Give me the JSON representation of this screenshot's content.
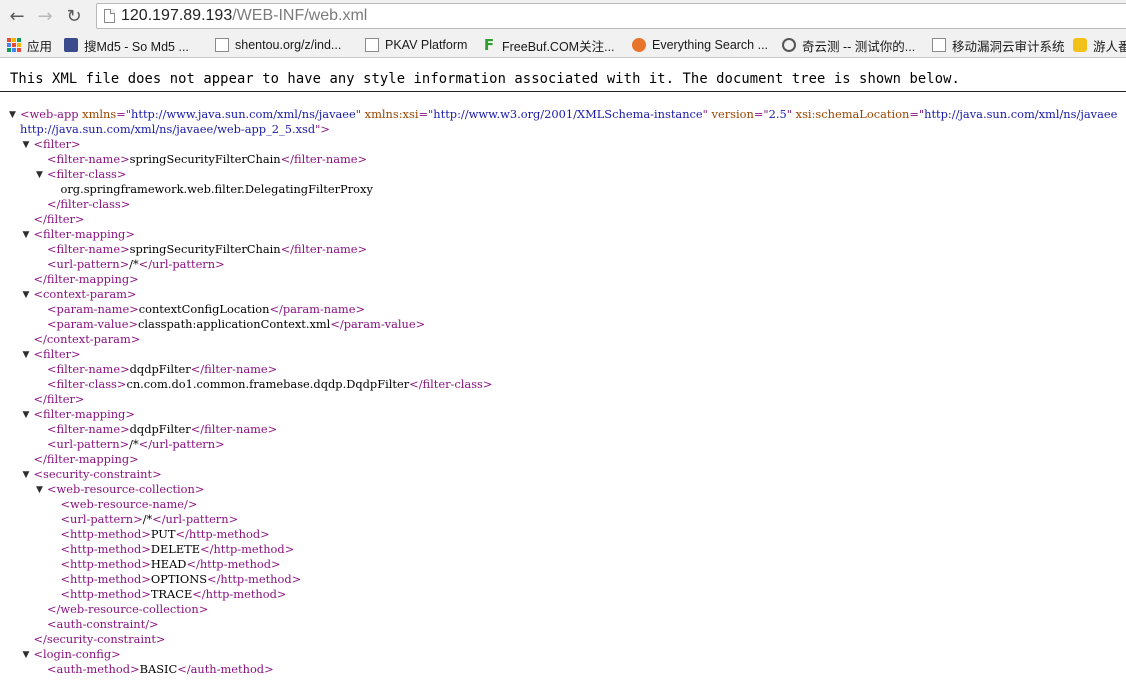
{
  "browser": {
    "url_host": "120.197.89.193",
    "url_path": "/WEB-INF/web.xml",
    "nav_icons": [
      "back-arrow-icon",
      "forward-arrow-icon",
      "reload-icon"
    ]
  },
  "bookmarks": [
    {
      "label": "应用",
      "icon": "apps-grid-icon"
    },
    {
      "label": "搜Md5 - So Md5 ...",
      "icon": "md5-icon"
    },
    {
      "label": "shentou.org/z/ind...",
      "icon": "page-icon"
    },
    {
      "label": "PKAV Platform",
      "icon": "page-icon"
    },
    {
      "label": "FreeBuf.COM关注...",
      "icon": "freebuf-icon"
    },
    {
      "label": "Everything Search ...",
      "icon": "everything-icon"
    },
    {
      "label": "奇云测 -- 测试你的...",
      "icon": "qiyun-icon"
    },
    {
      "label": "移动漏洞云审计系统",
      "icon": "page-icon"
    },
    {
      "label": "游人番",
      "icon": "game-icon"
    }
  ],
  "xml_info": "This XML file does not appear to have any style information associated with it. The document tree is shown below.",
  "xml_lines": [
    {
      "indent": 0,
      "toggle": true,
      "parts": [
        [
          "t",
          "<web-app "
        ],
        [
          "an",
          "xmlns"
        ],
        [
          "t",
          "=\""
        ],
        [
          "av",
          "http://www.java.sun.com/xml/ns/javaee"
        ],
        [
          "t",
          "\" "
        ],
        [
          "an",
          "xmlns:xsi"
        ],
        [
          "t",
          "=\""
        ],
        [
          "av",
          "http://www.w3.org/2001/XMLSchema-instance"
        ],
        [
          "t",
          "\" "
        ],
        [
          "an",
          "version"
        ],
        [
          "t",
          "=\""
        ],
        [
          "av",
          "2.5"
        ],
        [
          "t",
          "\" "
        ],
        [
          "an",
          "xsi:schemaLocation"
        ],
        [
          "t",
          "=\""
        ],
        [
          "av",
          "http://java.sun.com/xml/ns/javaee"
        ]
      ]
    },
    {
      "indent": 0,
      "toggle": false,
      "parts": [
        [
          "av",
          "http://java.sun.com/xml/ns/javaee/web-app_2_5.xsd"
        ],
        [
          "t",
          "\">"
        ]
      ]
    },
    {
      "indent": 1,
      "toggle": true,
      "parts": [
        [
          "t",
          "<filter>"
        ]
      ]
    },
    {
      "indent": 2,
      "toggle": false,
      "parts": [
        [
          "t",
          "<filter-name>"
        ],
        [
          "x",
          "springSecurityFilterChain"
        ],
        [
          "t",
          "</filter-name>"
        ]
      ]
    },
    {
      "indent": 2,
      "toggle": true,
      "parts": [
        [
          "t",
          "<filter-class>"
        ]
      ]
    },
    {
      "indent": 3,
      "toggle": false,
      "parts": [
        [
          "x",
          "org.springframework.web.filter.DelegatingFilterProxy"
        ]
      ]
    },
    {
      "indent": 2,
      "toggle": false,
      "parts": [
        [
          "t",
          "</filter-class>"
        ]
      ]
    },
    {
      "indent": 1,
      "toggle": false,
      "parts": [
        [
          "t",
          "</filter>"
        ]
      ]
    },
    {
      "indent": 1,
      "toggle": true,
      "parts": [
        [
          "t",
          "<filter-mapping>"
        ]
      ]
    },
    {
      "indent": 2,
      "toggle": false,
      "parts": [
        [
          "t",
          "<filter-name>"
        ],
        [
          "x",
          "springSecurityFilterChain"
        ],
        [
          "t",
          "</filter-name>"
        ]
      ]
    },
    {
      "indent": 2,
      "toggle": false,
      "parts": [
        [
          "t",
          "<url-pattern>"
        ],
        [
          "x",
          "/*"
        ],
        [
          "t",
          "</url-pattern>"
        ]
      ]
    },
    {
      "indent": 1,
      "toggle": false,
      "parts": [
        [
          "t",
          "</filter-mapping>"
        ]
      ]
    },
    {
      "indent": 1,
      "toggle": true,
      "parts": [
        [
          "t",
          "<context-param>"
        ]
      ]
    },
    {
      "indent": 2,
      "toggle": false,
      "parts": [
        [
          "t",
          "<param-name>"
        ],
        [
          "x",
          "contextConfigLocation"
        ],
        [
          "t",
          "</param-name>"
        ]
      ]
    },
    {
      "indent": 2,
      "toggle": false,
      "parts": [
        [
          "t",
          "<param-value>"
        ],
        [
          "x",
          "classpath:applicationContext.xml"
        ],
        [
          "t",
          "</param-value>"
        ]
      ]
    },
    {
      "indent": 1,
      "toggle": false,
      "parts": [
        [
          "t",
          "</context-param>"
        ]
      ]
    },
    {
      "indent": 1,
      "toggle": true,
      "parts": [
        [
          "t",
          "<filter>"
        ]
      ]
    },
    {
      "indent": 2,
      "toggle": false,
      "parts": [
        [
          "t",
          "<filter-name>"
        ],
        [
          "x",
          "dqdpFilter"
        ],
        [
          "t",
          "</filter-name>"
        ]
      ]
    },
    {
      "indent": 2,
      "toggle": false,
      "parts": [
        [
          "t",
          "<filter-class>"
        ],
        [
          "x",
          "cn.com.do1.common.framebase.dqdp.DqdpFilter"
        ],
        [
          "t",
          "</filter-class>"
        ]
      ]
    },
    {
      "indent": 1,
      "toggle": false,
      "parts": [
        [
          "t",
          "</filter>"
        ]
      ]
    },
    {
      "indent": 1,
      "toggle": true,
      "parts": [
        [
          "t",
          "<filter-mapping>"
        ]
      ]
    },
    {
      "indent": 2,
      "toggle": false,
      "parts": [
        [
          "t",
          "<filter-name>"
        ],
        [
          "x",
          "dqdpFilter"
        ],
        [
          "t",
          "</filter-name>"
        ]
      ]
    },
    {
      "indent": 2,
      "toggle": false,
      "parts": [
        [
          "t",
          "<url-pattern>"
        ],
        [
          "x",
          "/*"
        ],
        [
          "t",
          "</url-pattern>"
        ]
      ]
    },
    {
      "indent": 1,
      "toggle": false,
      "parts": [
        [
          "t",
          "</filter-mapping>"
        ]
      ]
    },
    {
      "indent": 1,
      "toggle": true,
      "parts": [
        [
          "t",
          "<security-constraint>"
        ]
      ]
    },
    {
      "indent": 2,
      "toggle": true,
      "parts": [
        [
          "t",
          "<web-resource-collection>"
        ]
      ]
    },
    {
      "indent": 3,
      "toggle": false,
      "parts": [
        [
          "t",
          "<web-resource-name/>"
        ]
      ]
    },
    {
      "indent": 3,
      "toggle": false,
      "parts": [
        [
          "t",
          "<url-pattern>"
        ],
        [
          "x",
          "/*"
        ],
        [
          "t",
          "</url-pattern>"
        ]
      ]
    },
    {
      "indent": 3,
      "toggle": false,
      "parts": [
        [
          "t",
          "<http-method>"
        ],
        [
          "x",
          "PUT"
        ],
        [
          "t",
          "</http-method>"
        ]
      ]
    },
    {
      "indent": 3,
      "toggle": false,
      "parts": [
        [
          "t",
          "<http-method>"
        ],
        [
          "x",
          "DELETE"
        ],
        [
          "t",
          "</http-method>"
        ]
      ]
    },
    {
      "indent": 3,
      "toggle": false,
      "parts": [
        [
          "t",
          "<http-method>"
        ],
        [
          "x",
          "HEAD"
        ],
        [
          "t",
          "</http-method>"
        ]
      ]
    },
    {
      "indent": 3,
      "toggle": false,
      "parts": [
        [
          "t",
          "<http-method>"
        ],
        [
          "x",
          "OPTIONS"
        ],
        [
          "t",
          "</http-method>"
        ]
      ]
    },
    {
      "indent": 3,
      "toggle": false,
      "parts": [
        [
          "t",
          "<http-method>"
        ],
        [
          "x",
          "TRACE"
        ],
        [
          "t",
          "</http-method>"
        ]
      ]
    },
    {
      "indent": 2,
      "toggle": false,
      "parts": [
        [
          "t",
          "</web-resource-collection>"
        ]
      ]
    },
    {
      "indent": 2,
      "toggle": false,
      "parts": [
        [
          "t",
          "<auth-constraint/>"
        ]
      ]
    },
    {
      "indent": 1,
      "toggle": false,
      "parts": [
        [
          "t",
          "</security-constraint>"
        ]
      ]
    },
    {
      "indent": 1,
      "toggle": true,
      "parts": [
        [
          "t",
          "<login-config>"
        ]
      ]
    },
    {
      "indent": 2,
      "toggle": false,
      "parts": [
        [
          "t",
          "<auth-method>"
        ],
        [
          "x",
          "BASIC"
        ],
        [
          "t",
          "</auth-method>"
        ]
      ]
    }
  ]
}
